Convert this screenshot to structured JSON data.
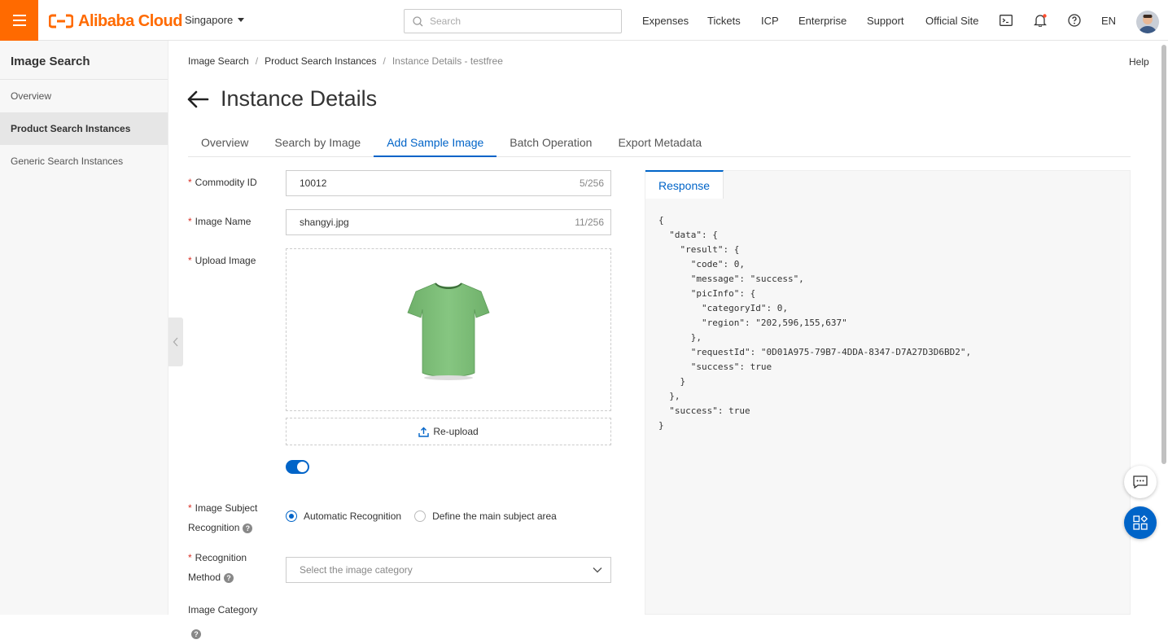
{
  "header": {
    "logo_text": "Alibaba Cloud",
    "region": "Singapore",
    "search_placeholder": "Search",
    "nav": [
      "Expenses",
      "Tickets",
      "ICP",
      "Enterprise",
      "Support",
      "Official Site"
    ],
    "lang": "EN",
    "accent": "#ff6a00"
  },
  "sidebar": {
    "title": "Image Search",
    "items": [
      {
        "label": "Overview"
      },
      {
        "label": "Product Search Instances"
      },
      {
        "label": "Generic Search Instances"
      }
    ]
  },
  "breadcrumb": {
    "items": [
      "Image Search",
      "Product Search Instances",
      "Instance Details - testfree"
    ],
    "separator": "/"
  },
  "help_label": "Help",
  "page_title": "Instance Details",
  "tabs": [
    {
      "label": "Overview"
    },
    {
      "label": "Search by Image"
    },
    {
      "label": "Add Sample Image"
    },
    {
      "label": "Batch Operation"
    },
    {
      "label": "Export Metadata"
    }
  ],
  "active_tab": "Add Sample Image",
  "form": {
    "required_mark": "*",
    "commodity_id": {
      "label": "Commodity ID",
      "value": "10012",
      "count": "5/256"
    },
    "image_name": {
      "label": "Image Name",
      "value": "shangyi.jpg",
      "count": "11/256"
    },
    "upload_image": {
      "label": "Upload Image",
      "reupload_label": "Re-upload"
    },
    "subject_recognition": {
      "label_line1": "Image Subject",
      "label_line2": "Recognition",
      "enabled": true
    },
    "recognition_method": {
      "label_line1": "Recognition",
      "label_line2": "Method",
      "options": [
        "Automatic Recognition",
        "Define the main subject area"
      ],
      "selected": "Automatic Recognition"
    },
    "image_category": {
      "label": "Image Category",
      "placeholder": "Select the image category"
    }
  },
  "response": {
    "tab_label": "Response",
    "lines": [
      "{",
      "  \"data\": {",
      "    \"result\": {",
      "      \"code\": 0,",
      "      \"message\": \"success\",",
      "      \"picInfo\": {",
      "        \"categoryId\": 0,",
      "        \"region\": \"202,596,155,637\"",
      "      },",
      "      \"requestId\": \"0D01A975-79B7-4DDA-8347-D7A27D3D6BD2\",",
      "      \"success\": true",
      "    }",
      "  },",
      "  \"success\": true",
      "}"
    ]
  },
  "colors": {
    "primary": "#0064c8",
    "tshirt": "#7fbf7a"
  }
}
